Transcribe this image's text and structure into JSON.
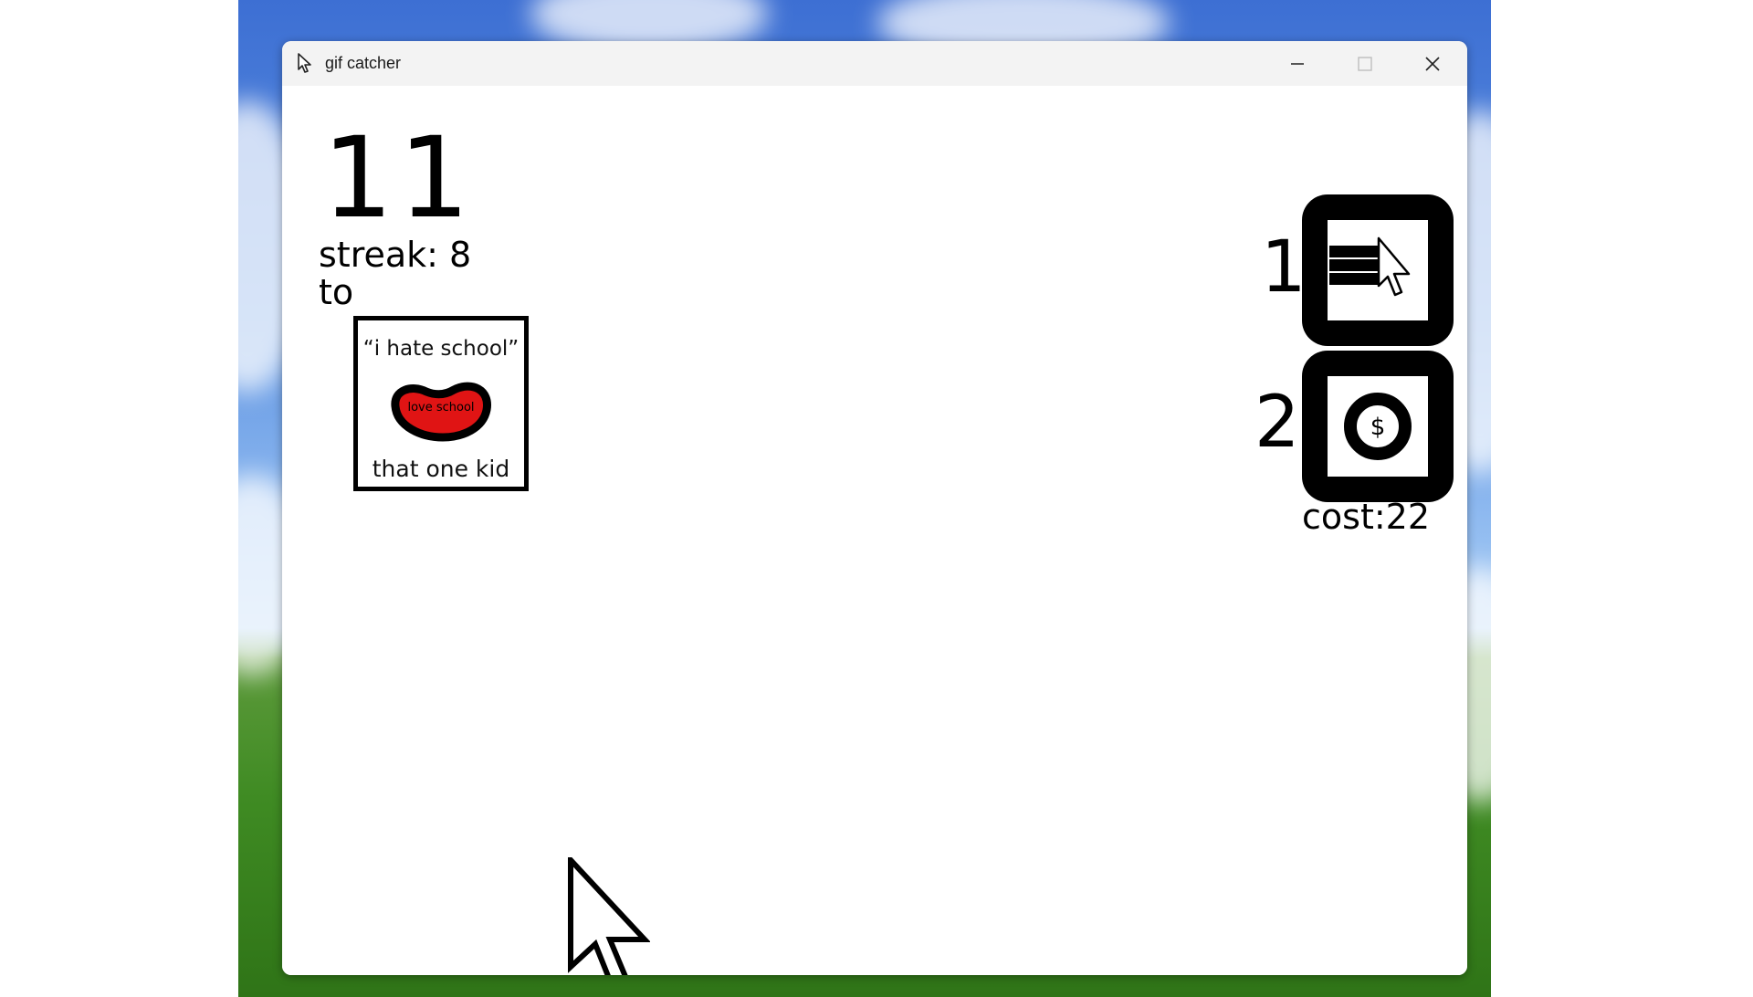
{
  "window": {
    "title": "gif catcher",
    "controls": [
      "minimize",
      "maximize",
      "close"
    ]
  },
  "game": {
    "score": "11",
    "streak": "streak: 8",
    "line3_visible": "to",
    "card": {
      "quote": "“i hate school”",
      "heart_text": "love school",
      "caption": "that one kid",
      "heart_color": "#e01414"
    },
    "shop": [
      {
        "number": "1",
        "icon": "list-cursor-icon"
      },
      {
        "number": "2",
        "icon": "dollar-coin-icon"
      }
    ],
    "cost": "cost:22"
  },
  "icons": [
    "app-cursor-icon",
    "minimize-icon",
    "maximize-icon",
    "close-icon",
    "large-cursor-icon"
  ]
}
